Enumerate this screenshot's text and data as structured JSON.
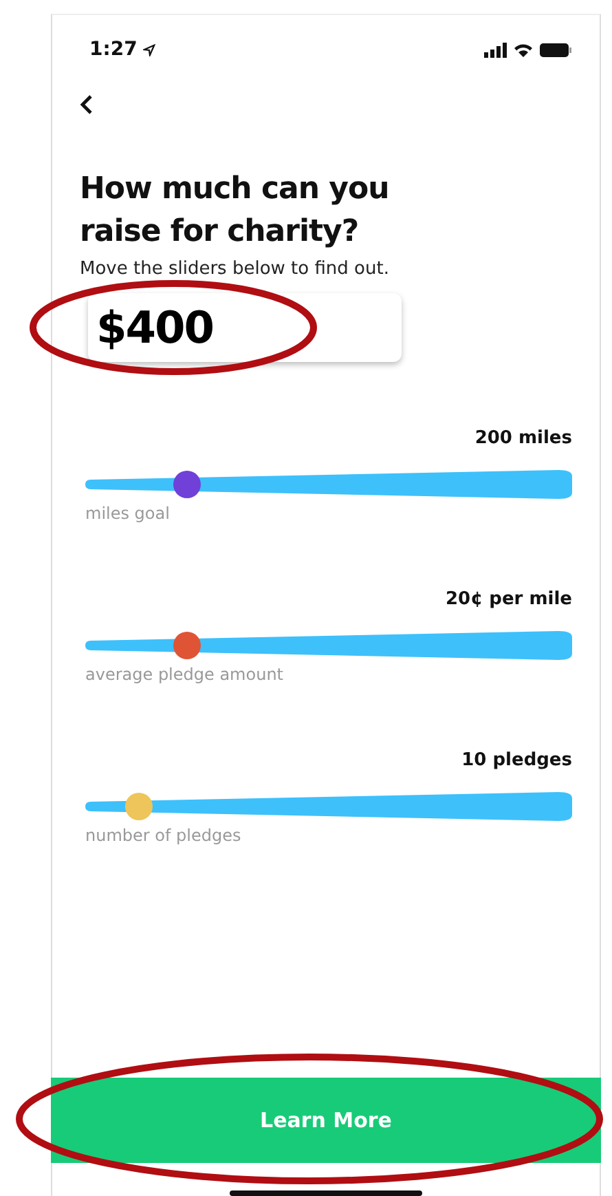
{
  "status_bar": {
    "time": "1:27"
  },
  "title": "How much can you raise for charity?",
  "subtitle": "Move the sliders below to find out.",
  "total": "$400",
  "sliders": [
    {
      "reading": "200 miles",
      "label": "miles goal",
      "level": 0.21,
      "color": "#7040d8"
    },
    {
      "reading": "20¢ per mile",
      "label": "average pledge amount",
      "level": 0.21,
      "color": "#e05436"
    },
    {
      "reading": "10 pledges",
      "label": "number of pledges",
      "level": 0.11,
      "color": "#eec55a"
    }
  ],
  "button": "Learn More"
}
